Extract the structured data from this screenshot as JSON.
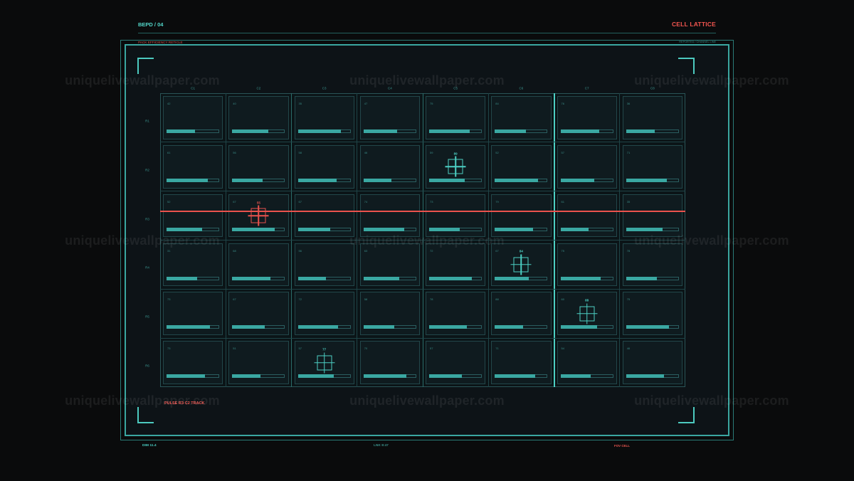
{
  "header": {
    "code": "BEPD / 04",
    "title": "CELL LATTICE",
    "left_caption": "PACK EFFICIENCY RETICLE",
    "right_caption": "REPORTED / CHANNEL LINE"
  },
  "watermark": "uniquelivewallpaper.com",
  "lattice": {
    "columns": [
      "C1",
      "C2",
      "C3",
      "C4",
      "C5",
      "C6",
      "C7",
      "C8"
    ],
    "rows": [
      "R1",
      "R2",
      "R3",
      "R4",
      "R5",
      "R6"
    ],
    "cells": [
      [
        {
          "id": "42",
          "level": 0.54
        },
        {
          "id": "40",
          "level": 0.68
        },
        {
          "id": "35",
          "level": 0.82
        },
        {
          "id": "47",
          "level": 0.64
        },
        {
          "id": "75",
          "level": 0.77
        },
        {
          "id": "84",
          "level": 0.59
        },
        {
          "id": "76",
          "level": 0.73
        },
        {
          "id": "36",
          "level": 0.55
        }
      ],
      [
        {
          "id": "61",
          "level": 0.78
        },
        {
          "id": "56",
          "level": 0.58
        },
        {
          "id": "58",
          "level": 0.73
        },
        {
          "id": "46",
          "level": 0.53
        },
        {
          "id": "59",
          "level": 0.68
        },
        {
          "id": "52",
          "level": 0.82
        },
        {
          "id": "57",
          "level": 0.64
        },
        {
          "id": "71",
          "level": 0.78
        }
      ],
      [
        {
          "id": "52",
          "level": 0.68
        },
        {
          "id": "67",
          "level": 0.81
        },
        {
          "id": "67",
          "level": 0.62
        },
        {
          "id": "74",
          "level": 0.77
        },
        {
          "id": "73",
          "level": 0.58
        },
        {
          "id": "79",
          "level": 0.73
        },
        {
          "id": "61",
          "level": 0.54
        },
        {
          "id": "35",
          "level": 0.69
        }
      ],
      [
        {
          "id": "31",
          "level": 0.58
        },
        {
          "id": "68",
          "level": 0.72
        },
        {
          "id": "56",
          "level": 0.53
        },
        {
          "id": "63",
          "level": 0.68
        },
        {
          "id": "72",
          "level": 0.81
        },
        {
          "id": "67",
          "level": 0.64
        },
        {
          "id": "75",
          "level": 0.77
        },
        {
          "id": "78",
          "level": 0.59
        }
      ],
      [
        {
          "id": "73",
          "level": 0.82
        },
        {
          "id": "67",
          "level": 0.62
        },
        {
          "id": "72",
          "level": 0.77
        },
        {
          "id": "58",
          "level": 0.58
        },
        {
          "id": "78",
          "level": 0.72
        },
        {
          "id": "88",
          "level": 0.54
        },
        {
          "id": "60",
          "level": 0.69
        },
        {
          "id": "75",
          "level": 0.82
        }
      ],
      [
        {
          "id": "73",
          "level": 0.73
        },
        {
          "id": "51",
          "level": 0.54
        },
        {
          "id": "57",
          "level": 0.68
        },
        {
          "id": "70",
          "level": 0.81
        },
        {
          "id": "57",
          "level": 0.62
        },
        {
          "id": "71",
          "level": 0.77
        },
        {
          "id": "54",
          "level": 0.58
        },
        {
          "id": "46",
          "level": 0.72
        }
      ]
    ],
    "markers": [
      {
        "row": 2,
        "column": 5,
        "label": "89"
      },
      {
        "row": 4,
        "column": 6,
        "label": "84"
      },
      {
        "row": 5,
        "column": 7,
        "label": "88"
      },
      {
        "row": 6,
        "column": 3,
        "label": "77"
      }
    ],
    "track": {
      "row": 3,
      "column": 2,
      "marker_label": "55",
      "label": "PULSE R3·C2 TRACK"
    }
  },
  "footer": {
    "left": "DIM 11.4",
    "center": "LNK 8:47",
    "right": "FOV CELL"
  },
  "colors": {
    "background": "#0a0b0c",
    "accent": "#4ccfc3",
    "alert": "#ea524d",
    "bar_fill": "#3aa8a2"
  }
}
